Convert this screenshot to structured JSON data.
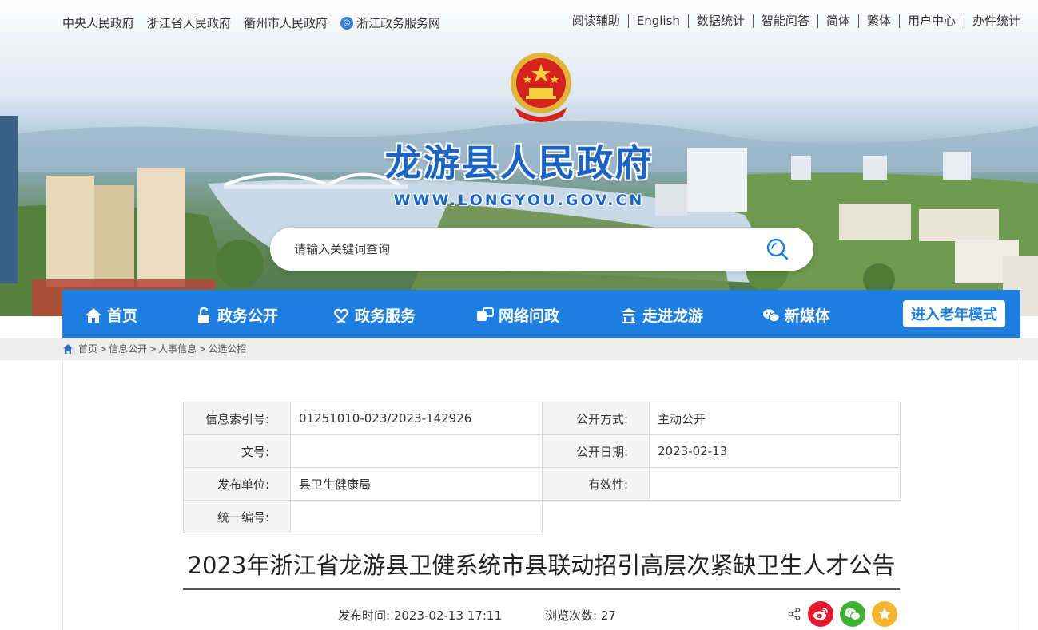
{
  "top_links_left": [
    {
      "label": "中央人民政府"
    },
    {
      "label": "浙江省人民政府"
    },
    {
      "label": "衢州市人民政府"
    },
    {
      "label": "浙江政务服务网",
      "icon": "service-net-icon"
    }
  ],
  "top_links_right": [
    {
      "label": "阅读辅助"
    },
    {
      "label": "English"
    },
    {
      "label": "数据统计"
    },
    {
      "label": "智能问答"
    },
    {
      "label": "简体"
    },
    {
      "label": "繁体"
    },
    {
      "label": "用户中心"
    },
    {
      "label": "办件统计"
    }
  ],
  "header": {
    "site_title": "龙游县人民政府",
    "site_url": "WWW.LONGYOU.GOV.CN"
  },
  "search": {
    "placeholder": "请输入关键词查询"
  },
  "nav": {
    "items": [
      {
        "label": "首页",
        "icon": "home-icon"
      },
      {
        "label": "政务公开",
        "icon": "lock-icon"
      },
      {
        "label": "政务服务",
        "icon": "heart-hand-icon"
      },
      {
        "label": "网络问政",
        "icon": "chat-box-icon"
      },
      {
        "label": "走进龙游",
        "icon": "pavilion-icon"
      },
      {
        "label": "新媒体",
        "icon": "wechat-icon"
      }
    ],
    "elder_mode": "进入老年模式"
  },
  "breadcrumb": {
    "items": [
      "首页",
      "信息公开",
      "人事信息",
      "公选公招"
    ],
    "separator": ">"
  },
  "meta": {
    "index_label": "信息索引号:",
    "index_value": "01251010-023/2023-142926",
    "open_mode_label": "公开方式:",
    "open_mode_value": "主动公开",
    "doc_no_label": "文号:",
    "doc_no_value": "",
    "open_date_label": "公开日期:",
    "open_date_value": "2023-02-13",
    "issuer_label": "发布单位:",
    "issuer_value": "县卫生健康局",
    "validity_label": "有效性:",
    "validity_value": "",
    "unified_no_label": "统一编号:",
    "unified_no_value": ""
  },
  "article": {
    "title": "2023年浙江省龙游县卫健系统市县联动招引高层次紧缺卫生人才公告",
    "publish_time_label": "发布时间:",
    "publish_time": "2023-02-13 17:11",
    "views_label": "浏览次数:",
    "views": "27"
  },
  "colors": {
    "nav_blue": "#1f7fe0",
    "title_blue": "#1b64c4",
    "weibo_red": "#e6162d",
    "wechat_green": "#3eb135",
    "favorite_gold": "#f5b52e"
  }
}
